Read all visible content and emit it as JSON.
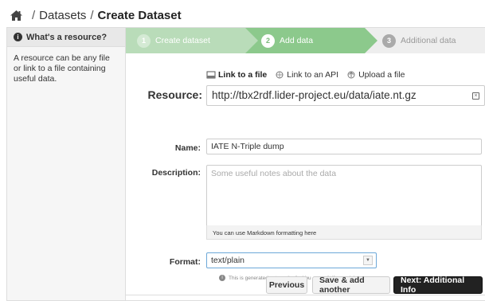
{
  "breadcrumb": {
    "home_icon": "home-icon",
    "separator": "/",
    "section": "Datasets",
    "current": "Create Dataset"
  },
  "sidebar": {
    "title": "What's a resource?",
    "icon": "info-icon",
    "body": "A resource can be any file or link to a file containing useful data."
  },
  "stages": [
    {
      "number": "1",
      "label": "Create dataset",
      "state": "complete"
    },
    {
      "number": "2",
      "label": "Add data",
      "state": "active"
    },
    {
      "number": "3",
      "label": "Additional data",
      "state": "upcoming"
    }
  ],
  "resource_tabs": [
    {
      "label": "Link to a file",
      "icon": "link-file-icon",
      "active": true
    },
    {
      "label": "Link to an API",
      "icon": "link-api-icon",
      "active": false
    },
    {
      "label": "Upload a file",
      "icon": "upload-icon",
      "active": false
    }
  ],
  "form": {
    "resource_label": "Resource:",
    "resource_value": "http://tbx2rdf.lider-project.eu/data/iate.nt.gz",
    "name_label": "Name:",
    "name_value": "IATE N-Triple dump",
    "description_label": "Description:",
    "description_placeholder": "Some useful notes about the data",
    "description_hint": "You can use Markdown formatting here",
    "format_label": "Format:",
    "format_value": "text/plain",
    "format_hint": "This is generated automatically. You can edit if you wish"
  },
  "actions": {
    "previous": "Previous",
    "save_another": "Save & add another",
    "next": "Next: Additional Info"
  },
  "colors": {
    "stage_complete": "#b9dcb9",
    "stage_active": "#8cc98c",
    "stage_upcoming": "#eeeeee",
    "primary_button": "#222222"
  }
}
